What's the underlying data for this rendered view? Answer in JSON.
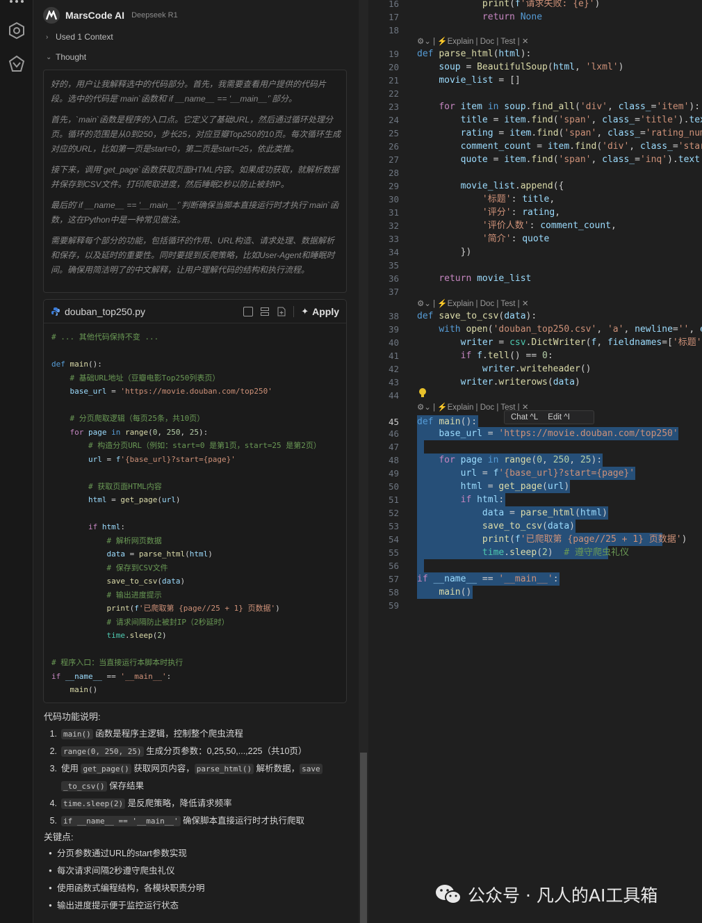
{
  "chat": {
    "title": "MarsCode AI",
    "model": "Deepseek R1",
    "context_label": "Used 1 Context",
    "thought_label": "Thought",
    "thought_paragraphs": [
      "好的，用户让我解释选中的代码部分。首先，我需要查看用户提供的代码片段。选中的代码是`main`函数和`if __name__ == '__main__'`部分。",
      "首先，`main`函数是程序的入口点。它定义了基础URL，然后通过循环处理分页。循环的范围是从0到250，步长25，对应豆瓣Top250的10页。每次循环生成对应的URL，比如第一页是start=0，第二页是start=25，依此类推。",
      "接下来，调用`get_page`函数获取页面HTML内容。如果成功获取，就解析数据并保存到CSV文件。打印爬取进度，然后睡眠2秒以防止被封IP。",
      "最后的`if __name__ == '__main__'`判断确保当脚本直接运行时才执行`main`函数，这在Python中是一种常见做法。",
      "需要解释每个部分的功能，包括循环的作用、URL构造、请求处理、数据解析和保存，以及延时的重要性。同时要提到反爬策略，比如User-Agent和睡眠时间。确保用简洁明了的中文解释，让用户理解代码的结构和执行流程。"
    ],
    "code_card": {
      "file_name": "douban_top250.py",
      "apply_label": "Apply",
      "lines": [
        "# ... 其他代码保持不变 ...",
        "",
        "def main():",
        "    # 基础URL地址（豆瓣电影Top250列表页）",
        "    base_url = 'https://movie.douban.com/top250'",
        "",
        "    # 分页爬取逻辑（每页25条，共10页）",
        "    for page in range(0, 250, 25):",
        "        # 构造分页URL（例如：start=0 是第1页，start=25 是第2页）",
        "        url = f'{base_url}?start={page}'",
        "",
        "        # 获取页面HTML内容",
        "        html = get_page(url)",
        "",
        "        if html:",
        "            # 解析网页数据",
        "            data = parse_html(html)",
        "            # 保存到CSV文件",
        "            save_to_csv(data)",
        "            # 输出进度提示",
        "            print(f'已爬取第 {page//25 + 1} 页数据')",
        "            # 请求间隔防止被封IP（2秒延时）",
        "            time.sleep(2)",
        "",
        "# 程序入口：当直接运行本脚本时执行",
        "if __name__ == '__main__':",
        "    main()"
      ]
    },
    "explanation_title": "代码功能说明:",
    "explanation_items": [
      {
        "num": "1.",
        "code": "main()",
        "text": " 函数是程序主逻辑，控制整个爬虫流程"
      },
      {
        "num": "2.",
        "code": "range(0, 250, 25)",
        "text": " 生成分页参数：0,25,50,...,225（共10页）"
      },
      {
        "num": "3.",
        "pre": "使用 ",
        "code": "get_page()",
        "text": " 获取网页内容，",
        "code2": "parse_html()",
        "text2": " 解析数据，",
        "code3": "save",
        "code4": "_to_csv()",
        "text3": " 保存结果"
      },
      {
        "num": "4.",
        "code": "time.sleep(2)",
        "text": " 是反爬策略，降低请求频率"
      },
      {
        "num": "5.",
        "code": "if __name__ == '__main__'",
        "text": " 确保脚本直接运行时才执行爬取"
      }
    ],
    "key_points_title": "关键点:",
    "key_points": [
      "分页参数通过URL的start参数实现",
      "每次请求间隔2秒遵守爬虫礼仪",
      "使用函数式编程结构，各模块职责分明",
      "输出进度提示便于监控运行状态"
    ]
  },
  "editor": {
    "code_lens": "Explain | Doc | Test | ✕",
    "hint": {
      "chat": "Chat ^L",
      "edit": "Edit ^I"
    },
    "line_numbers": [
      "16",
      "17",
      "18",
      "19",
      "20",
      "21",
      "22",
      "23",
      "24",
      "25",
      "26",
      "27",
      "28",
      "29",
      "30",
      "31",
      "32",
      "33",
      "34",
      "35",
      "36",
      "37",
      "38",
      "39",
      "40",
      "41",
      "42",
      "43",
      "44",
      "45",
      "46",
      "47",
      "48",
      "49",
      "50",
      "51",
      "52",
      "53",
      "54",
      "55",
      "56",
      "57",
      "58",
      "59"
    ],
    "lines": [
      "            print(f'请求失败: {e}')",
      "            return None",
      "",
      "def parse_html(html):",
      "    soup = BeautifulSoup(html, 'lxml')",
      "    movie_list = []",
      "",
      "    for item in soup.find_all('div', class_='item'):",
      "        title = item.find('span', class_='title').tex",
      "        rating = item.find('span', class_='rating_num",
      "        comment_count = item.find('div', class_='star",
      "        quote = item.find('span', class_='inq').text",
      "",
      "        movie_list.append({",
      "            '标题': title,",
      "            '评分': rating,",
      "            '评价人数': comment_count,",
      "            '简介': quote",
      "        })",
      "",
      "    return movie_list",
      "",
      "def save_to_csv(data):",
      "    with open('douban_top250.csv', 'a', newline='', e",
      "        writer = csv.DictWriter(f, fieldnames=['标题'",
      "        if f.tell() == 0:",
      "            writer.writeheader()",
      "        writer.writerows(data)",
      "",
      "def main():",
      "    base_url = 'https://movie.douban.com/top250'",
      "",
      "    for page in range(0, 250, 25):",
      "        url = f'{base_url}?start={page}'",
      "        html = get_page(url)",
      "        if html:",
      "            data = parse_html(html)",
      "            save_to_csv(data)",
      "            print(f'已爬取第 {page//25 + 1} 页数据')",
      "            time.sleep(2)  # 遵守爬虫礼仪",
      "",
      "if __name__ == '__main__':",
      "    main()",
      ""
    ]
  },
  "watermark": "公众号 · 凡人的AI工具箱"
}
